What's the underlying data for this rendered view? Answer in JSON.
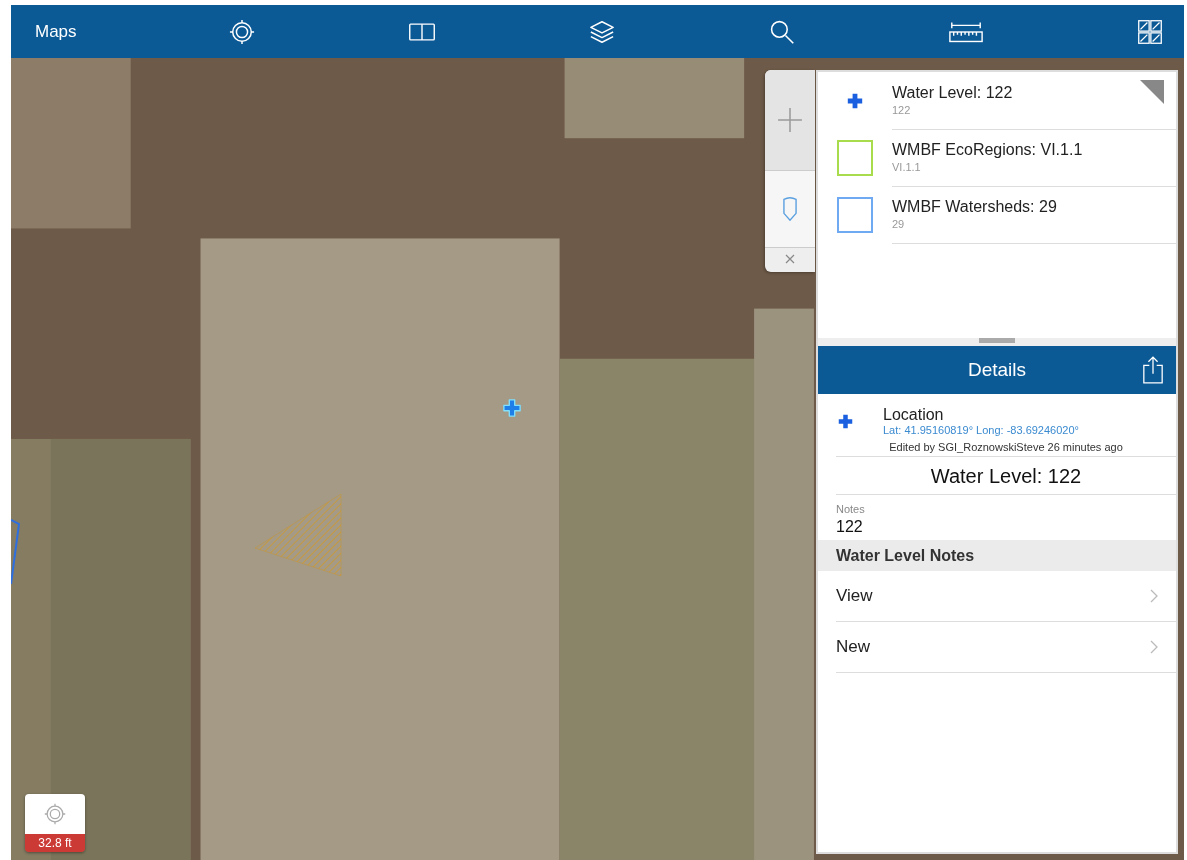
{
  "top_bar": {
    "title": "Maps"
  },
  "side_tabs": [
    {
      "kind": "add",
      "selected": false
    },
    {
      "kind": "marker",
      "selected": true
    }
  ],
  "results": [
    {
      "kind": "point",
      "title": "Water Level: 122",
      "subtitle": "122",
      "color": "#1a5fe0"
    },
    {
      "kind": "polygon",
      "title": "WMBF EcoRegions: VI.1.1",
      "subtitle": "VI.1.1",
      "color": "#a8dc4c"
    },
    {
      "kind": "polygon",
      "title": "WMBF Watersheds: 29",
      "subtitle": "29",
      "color": "#6fa9f2"
    }
  ],
  "details": {
    "title": "Details",
    "location_label": "Location",
    "coordinates": "Lat: 41.95160819° Long: -83.69246020°",
    "edited": "Edited by SGI_RoznowskiSteve 26 minutes ago",
    "feature_title": "Water Level: 122",
    "fields": [
      {
        "label": "Notes",
        "value": "122"
      }
    ],
    "section": "Water Level Notes",
    "actions": [
      "View",
      "New"
    ]
  },
  "scale": {
    "reading": "32.8 ft"
  }
}
